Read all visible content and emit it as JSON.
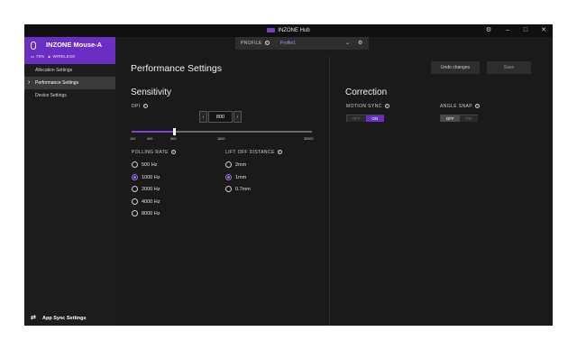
{
  "app": {
    "title": "INZONE Hub"
  },
  "window_controls": {
    "settings": "⚙",
    "minimize": "–",
    "maximize": "□",
    "close": "✕"
  },
  "sidebar": {
    "device_name": "INZONE Mouse-A",
    "battery": "70%",
    "connection": "WIRELESS",
    "items": [
      {
        "label": "Allocation Settings"
      },
      {
        "label": "Performance Settings"
      },
      {
        "label": "Device Settings"
      }
    ],
    "app_sync": "App Sync Settings"
  },
  "profile": {
    "label": "PROFILE",
    "value": "Profile1"
  },
  "page": {
    "title": "Performance Settings",
    "undo": "Undo changes",
    "save": "Save"
  },
  "sensitivity": {
    "title": "Sensitivity",
    "dpi_label": "DPI",
    "dpi_value": "800",
    "dpi_min": 100,
    "dpi_max": 30000,
    "ticks": [
      "100",
      "400",
      "800",
      "1600",
      "30000"
    ]
  },
  "polling": {
    "label": "POLLING RATE",
    "options": [
      "500 Hz",
      "1000 Hz",
      "2000 Hz",
      "4000 Hz",
      "8000 Hz"
    ],
    "selected": "1000 Hz"
  },
  "liftoff": {
    "label": "LIFT OFF DISTANCE",
    "options": [
      "2mm",
      "1mm",
      "0.7mm"
    ],
    "selected": "1mm"
  },
  "correction": {
    "title": "Correction",
    "motion_sync": {
      "label": "MOTION SYNC",
      "off": "OFF",
      "on": "ON",
      "state": "ON"
    },
    "angle_snap": {
      "label": "ANGLE SNAP",
      "off": "OFF",
      "on": "ON",
      "state": "OFF"
    }
  },
  "colors": {
    "accent": "#6a2ec4",
    "bg": "#1a1a1a",
    "sidebar": "#1c1c1c"
  }
}
